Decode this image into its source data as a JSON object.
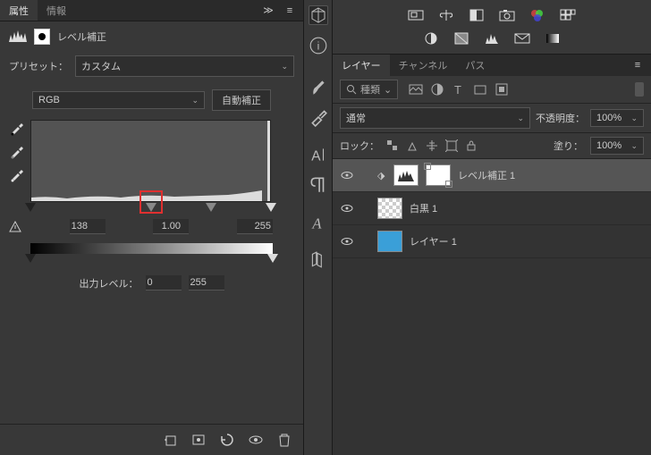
{
  "leftPanel": {
    "tabs": {
      "active": "属性",
      "inactive": "情報"
    },
    "title": "レベル補正",
    "presetLabel": "プリセット：",
    "presetValue": "カスタム",
    "channelValue": "RGB",
    "autoBtn": "自動補正",
    "inputs": {
      "black": "138",
      "gamma": "1.00",
      "white": "255"
    },
    "outputLabel": "出力レベル：",
    "output": {
      "black": "0",
      "white": "255"
    }
  },
  "rightPanel": {
    "layersTabs": {
      "layers": "レイヤー",
      "channels": "チャンネル",
      "paths": "パス"
    },
    "searchLabel": "種類",
    "blendMode": "通常",
    "opacityLabel": "不透明度：",
    "opacityValue": "100%",
    "lockLabel": "ロック：",
    "fillLabel": "塗り：",
    "fillValue": "100%",
    "layers": [
      {
        "name": "レベル補正 1",
        "type": "levels"
      },
      {
        "name": "白黒 1",
        "type": "checker"
      },
      {
        "name": "レイヤー 1",
        "type": "blue"
      }
    ]
  }
}
